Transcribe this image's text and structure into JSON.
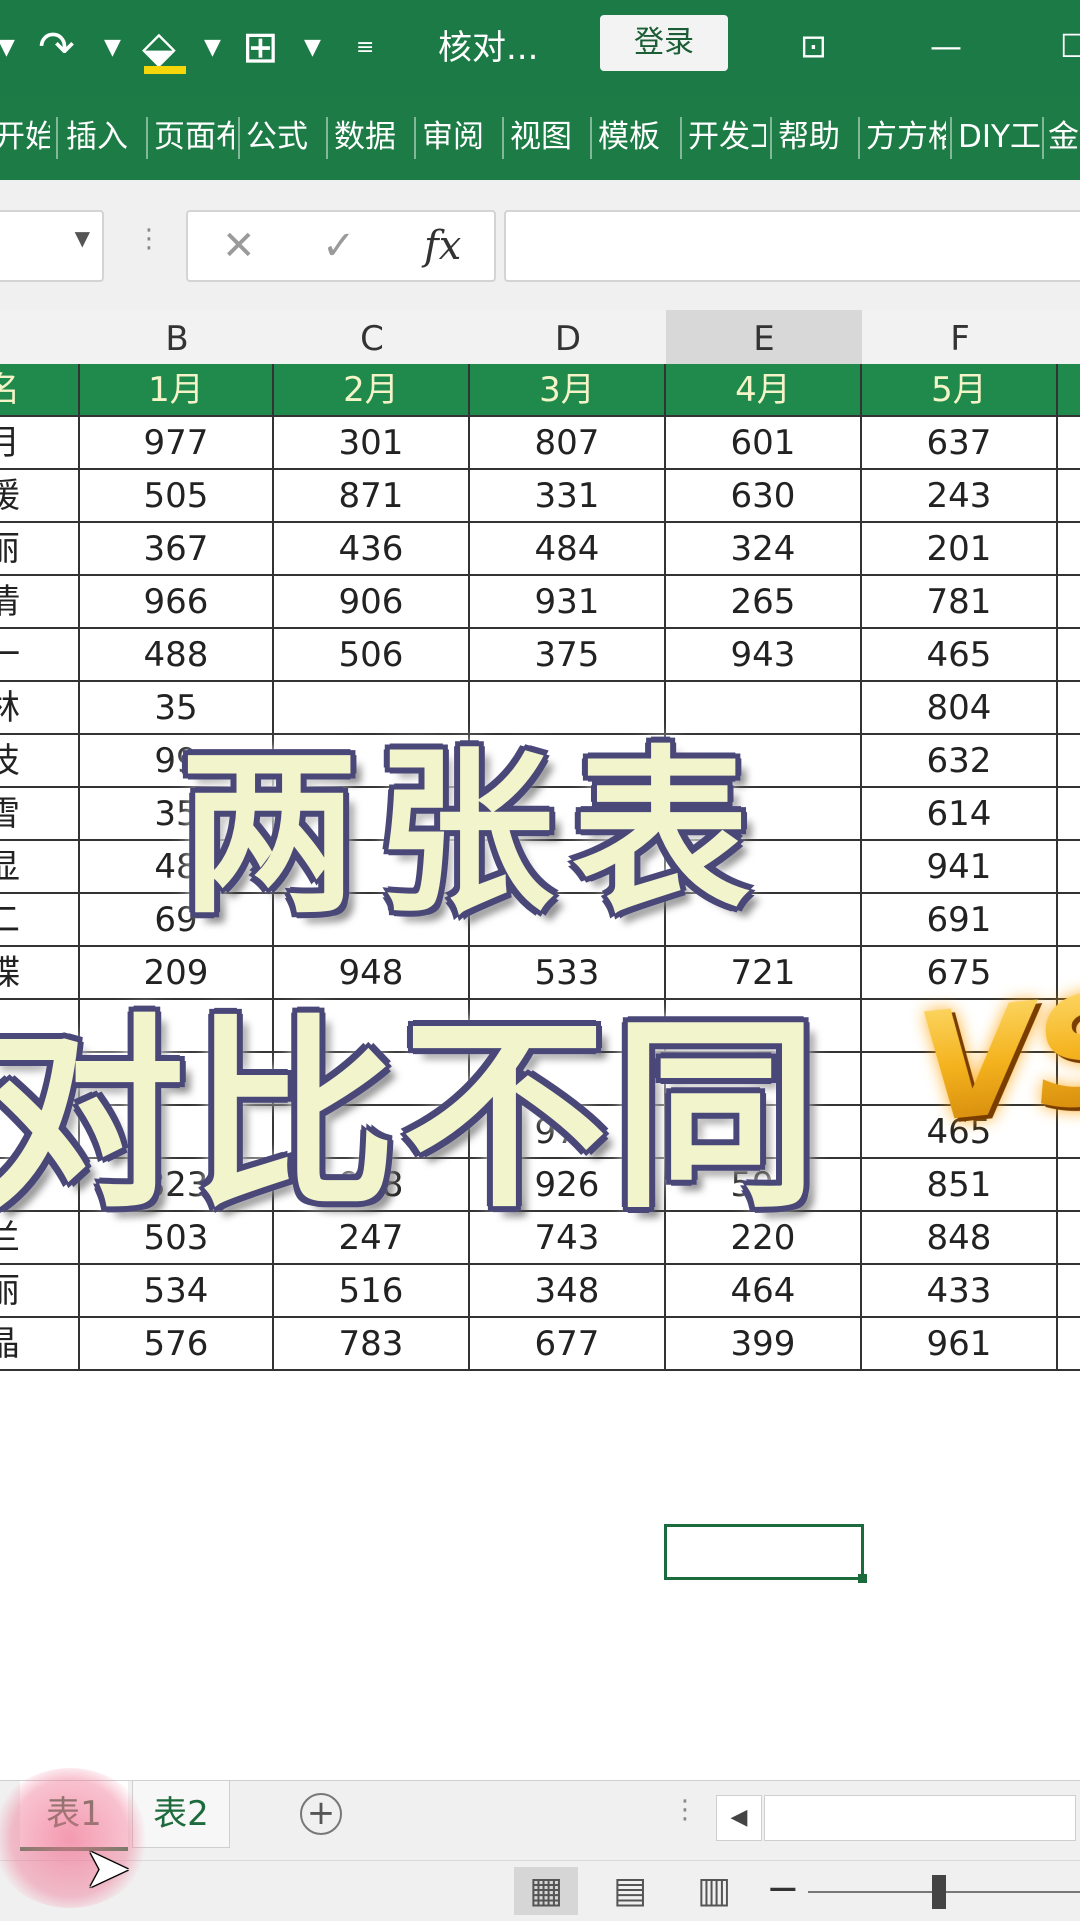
{
  "titlebar": {
    "redo_icon": "redo-icon",
    "paint_icon": "fill-color-icon",
    "border_icon": "border-icon",
    "doc_title": "核对...",
    "login_label": "登录",
    "restore_icon": "ribbon-display-icon",
    "minimize_symbol": "—",
    "maximize_symbol": "☐"
  },
  "ribbon": {
    "tabs": [
      "开始",
      "插入",
      "页面布",
      "公式",
      "数据",
      "审阅",
      "视图",
      "模板",
      "开发工",
      "帮助",
      "方方格",
      "DIY工",
      "金"
    ]
  },
  "formula_bar": {
    "cancel_symbol": "✕",
    "enter_symbol": "✓",
    "fx_label": "fx",
    "dots": "⋮",
    "name_box_value": ""
  },
  "sheet": {
    "column_headers": [
      "B",
      "C",
      "D",
      "E",
      "F"
    ],
    "selected_column": "E",
    "header_row": [
      "名",
      "1月",
      "2月",
      "3月",
      "4月",
      "5月"
    ],
    "rows": [
      [
        "月",
        "977",
        "301",
        "807",
        "601",
        "637"
      ],
      [
        "媛",
        "505",
        "871",
        "331",
        "630",
        "243"
      ],
      [
        "丽",
        "367",
        "436",
        "484",
        "324",
        "201"
      ],
      [
        "倩",
        "966",
        "906",
        "931",
        "265",
        "781"
      ],
      [
        "一",
        "488",
        "506",
        "375",
        "943",
        "465"
      ],
      [
        "林",
        "35",
        "",
        "",
        "",
        "804"
      ],
      [
        "技",
        "99",
        "",
        "",
        "",
        "632"
      ],
      [
        "雪",
        "35",
        "",
        "",
        "",
        "614"
      ],
      [
        "显",
        "48",
        "",
        "",
        "",
        "941"
      ],
      [
        "二",
        "69",
        "",
        "",
        "",
        "691"
      ],
      [
        "蝶",
        "209",
        "948",
        "533",
        "721",
        "675"
      ],
      [
        "",
        "",
        "",
        "",
        "",
        ""
      ],
      [
        "",
        "",
        "",
        "",
        "",
        ""
      ],
      [
        "",
        "",
        "",
        "975",
        "",
        "465"
      ],
      [
        "艺",
        "823",
        "968",
        "926",
        "590",
        "851"
      ],
      [
        "兰",
        "503",
        "247",
        "743",
        "220",
        "848"
      ],
      [
        "丽",
        "534",
        "516",
        "348",
        "464",
        "433"
      ],
      [
        "晶",
        "576",
        "783",
        "677",
        "399",
        "961"
      ]
    ]
  },
  "overlay": {
    "line1": "两张表",
    "line2": "对比不同",
    "badge": "VS"
  },
  "sheet_tabs": {
    "tabs": [
      "表1",
      "表2"
    ],
    "active": "表1",
    "add_symbol": "+",
    "dots": "⋮",
    "scroll_left_symbol": "◀"
  },
  "status_bar": {
    "normal_view_icon": "▦",
    "page_layout_icon": "▤",
    "page_break_icon": "▥",
    "zoom_minus": "−"
  },
  "colors": {
    "ribbon_green": "#1d7c46",
    "header_green": "#1f8a4c",
    "overlay_text": "#f2f4cc",
    "overlay_outline": "#4a4878"
  }
}
